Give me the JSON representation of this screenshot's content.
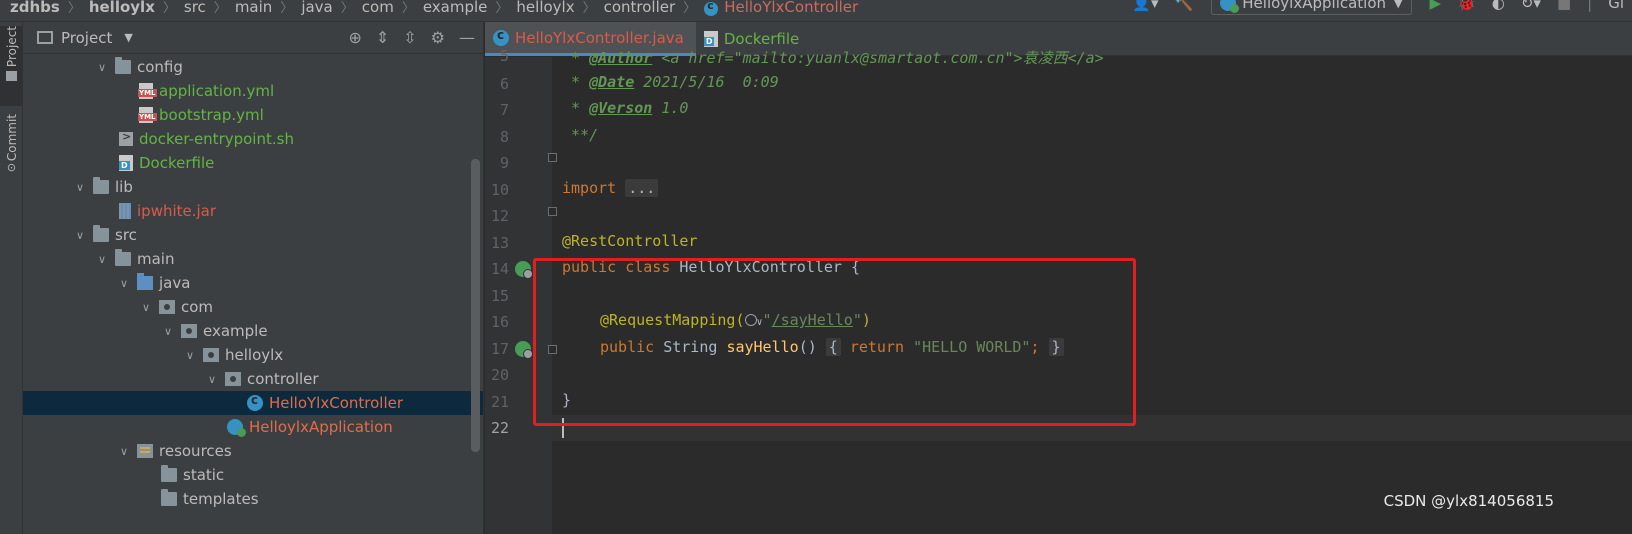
{
  "breadcrumb": {
    "items": [
      "zdhbs",
      "helloylx",
      "src",
      "main",
      "java",
      "com",
      "example",
      "helloylx",
      "controller",
      "HelloYlxController"
    ],
    "separator": "〉"
  },
  "toolbar": {
    "run_config": "HelloylxApplication",
    "right_cut_label": "Gi"
  },
  "toolstrip": {
    "project_label": "Project",
    "commit_label": "Commit"
  },
  "project_panel": {
    "title": "Project",
    "tree": [
      {
        "label": "config",
        "icon": "folder-icon",
        "expanded": true,
        "color": "plain"
      },
      {
        "label": "application.yml",
        "icon": "yml-file-icon",
        "color": "green"
      },
      {
        "label": "bootstrap.yml",
        "icon": "yml-file-icon",
        "color": "green"
      },
      {
        "label": "docker-entrypoint.sh",
        "icon": "shell-file-icon",
        "color": "green"
      },
      {
        "label": "Dockerfile",
        "icon": "docker-file-icon",
        "color": "green"
      },
      {
        "label": "lib",
        "icon": "folder-icon",
        "expanded": true,
        "color": "plain"
      },
      {
        "label": "ipwhite.jar",
        "icon": "jar-icon",
        "color": "red"
      },
      {
        "label": "src",
        "icon": "folder-icon",
        "expanded": true,
        "color": "plain"
      },
      {
        "label": "main",
        "icon": "folder-icon",
        "expanded": true,
        "color": "plain"
      },
      {
        "label": "java",
        "icon": "source-folder-icon",
        "expanded": true,
        "color": "plain"
      },
      {
        "label": "com",
        "icon": "package-icon",
        "expanded": true,
        "color": "plain"
      },
      {
        "label": "example",
        "icon": "package-icon",
        "expanded": true,
        "color": "plain"
      },
      {
        "label": "helloylx",
        "icon": "package-icon",
        "expanded": true,
        "color": "plain"
      },
      {
        "label": "controller",
        "icon": "package-icon",
        "expanded": true,
        "color": "plain"
      },
      {
        "label": "HelloYlxController",
        "icon": "class-icon",
        "color": "red",
        "selected": true
      },
      {
        "label": "HelloylxApplication",
        "icon": "spring-app-icon",
        "color": "red"
      },
      {
        "label": "resources",
        "icon": "resources-folder-icon",
        "expanded": true,
        "color": "plain"
      },
      {
        "label": "static",
        "icon": "folder-icon",
        "color": "plain"
      },
      {
        "label": "templates",
        "icon": "folder-icon",
        "color": "plain"
      }
    ]
  },
  "editor": {
    "tabs": [
      {
        "label": "HelloYlxController.java",
        "active": true
      },
      {
        "label": "Dockerfile",
        "active": false
      }
    ],
    "line_numbers": [
      "5",
      "6",
      "7",
      "8",
      "9",
      "10",
      "12",
      "13",
      "14",
      "15",
      "16",
      "17",
      "20",
      "21",
      "22"
    ],
    "code": {
      "l5_a": " * ",
      "l5_tag": "@Author",
      "l5_b": " <a href=\"mailto:yuanlx@smartaot.com.cn\">袁凌西</a>",
      "l6_a": " * ",
      "l6_tag": "@Date",
      "l6_b": " 2021/5/16  0:09",
      "l7_a": " * ",
      "l7_tag": "@Verson",
      "l7_b": " 1.0",
      "l8": " **/",
      "l10_kw": "import",
      "l10_fold": "...",
      "l13": "@RestController",
      "l14_kw": "public class",
      "l14_rest": " HelloYlxController {",
      "l16_ann": "@RequestMapping(",
      "l16_q1": "\"",
      "l16_link": "/sayHello",
      "l16_q2": "\"",
      "l16_end": ")",
      "l17_kw": "public",
      "l17_type": " String ",
      "l17_fn": "sayHello",
      "l17_paren": "()",
      "l17_body_open": "{",
      "l17_ret": "return",
      "l17_str": "\"HELLO WORLD\"",
      "l17_semi": ";",
      "l17_body_close": "}",
      "l21": "}"
    }
  },
  "watermark": "CSDN @ylx814056815",
  "colors": {
    "highlight_box": "#e02020",
    "accent": "#4a88c7"
  }
}
